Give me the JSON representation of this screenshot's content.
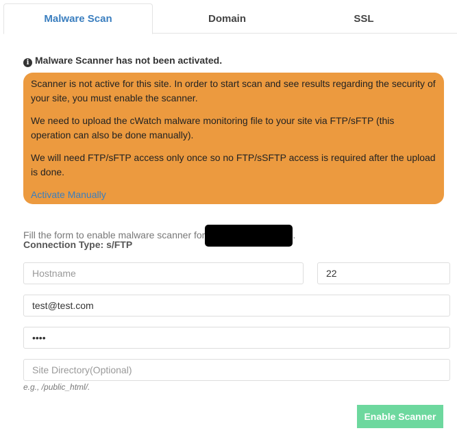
{
  "tabs": [
    {
      "label": "Malware Scan"
    },
    {
      "label": "Domain"
    },
    {
      "label": "SSL"
    }
  ],
  "notice": "Malware Scanner has not been activated.",
  "alert": {
    "p1": "Scanner is not active for this site. In order to start scan and see results regarding the security of your site, you must enable the scanner.",
    "p2": "We need to upload the cWatch malware monitoring file to your site via FTP/sFTP (this operation can also be done manually).",
    "p3": "We will need FTP/sFTP access only once so no FTP/sSFTP access is required after the upload is done.",
    "link": "Activate Manually"
  },
  "form": {
    "intro": "Fill the form to enable malware scanner for",
    "intro_end": ".",
    "connection_type": "Connection Type: s/FTP",
    "hostname_placeholder": "Hostname",
    "port_value": "22",
    "username_value": "test@test.com",
    "password_value": "test",
    "directory_placeholder": "Site Directory(Optional)",
    "hint": "e.g., /public_html/.",
    "submit": "Enable Scanner"
  },
  "colors": {
    "alert": "#ec9a3f",
    "accent": "#3a7ebf",
    "button": "#6dd89e"
  }
}
